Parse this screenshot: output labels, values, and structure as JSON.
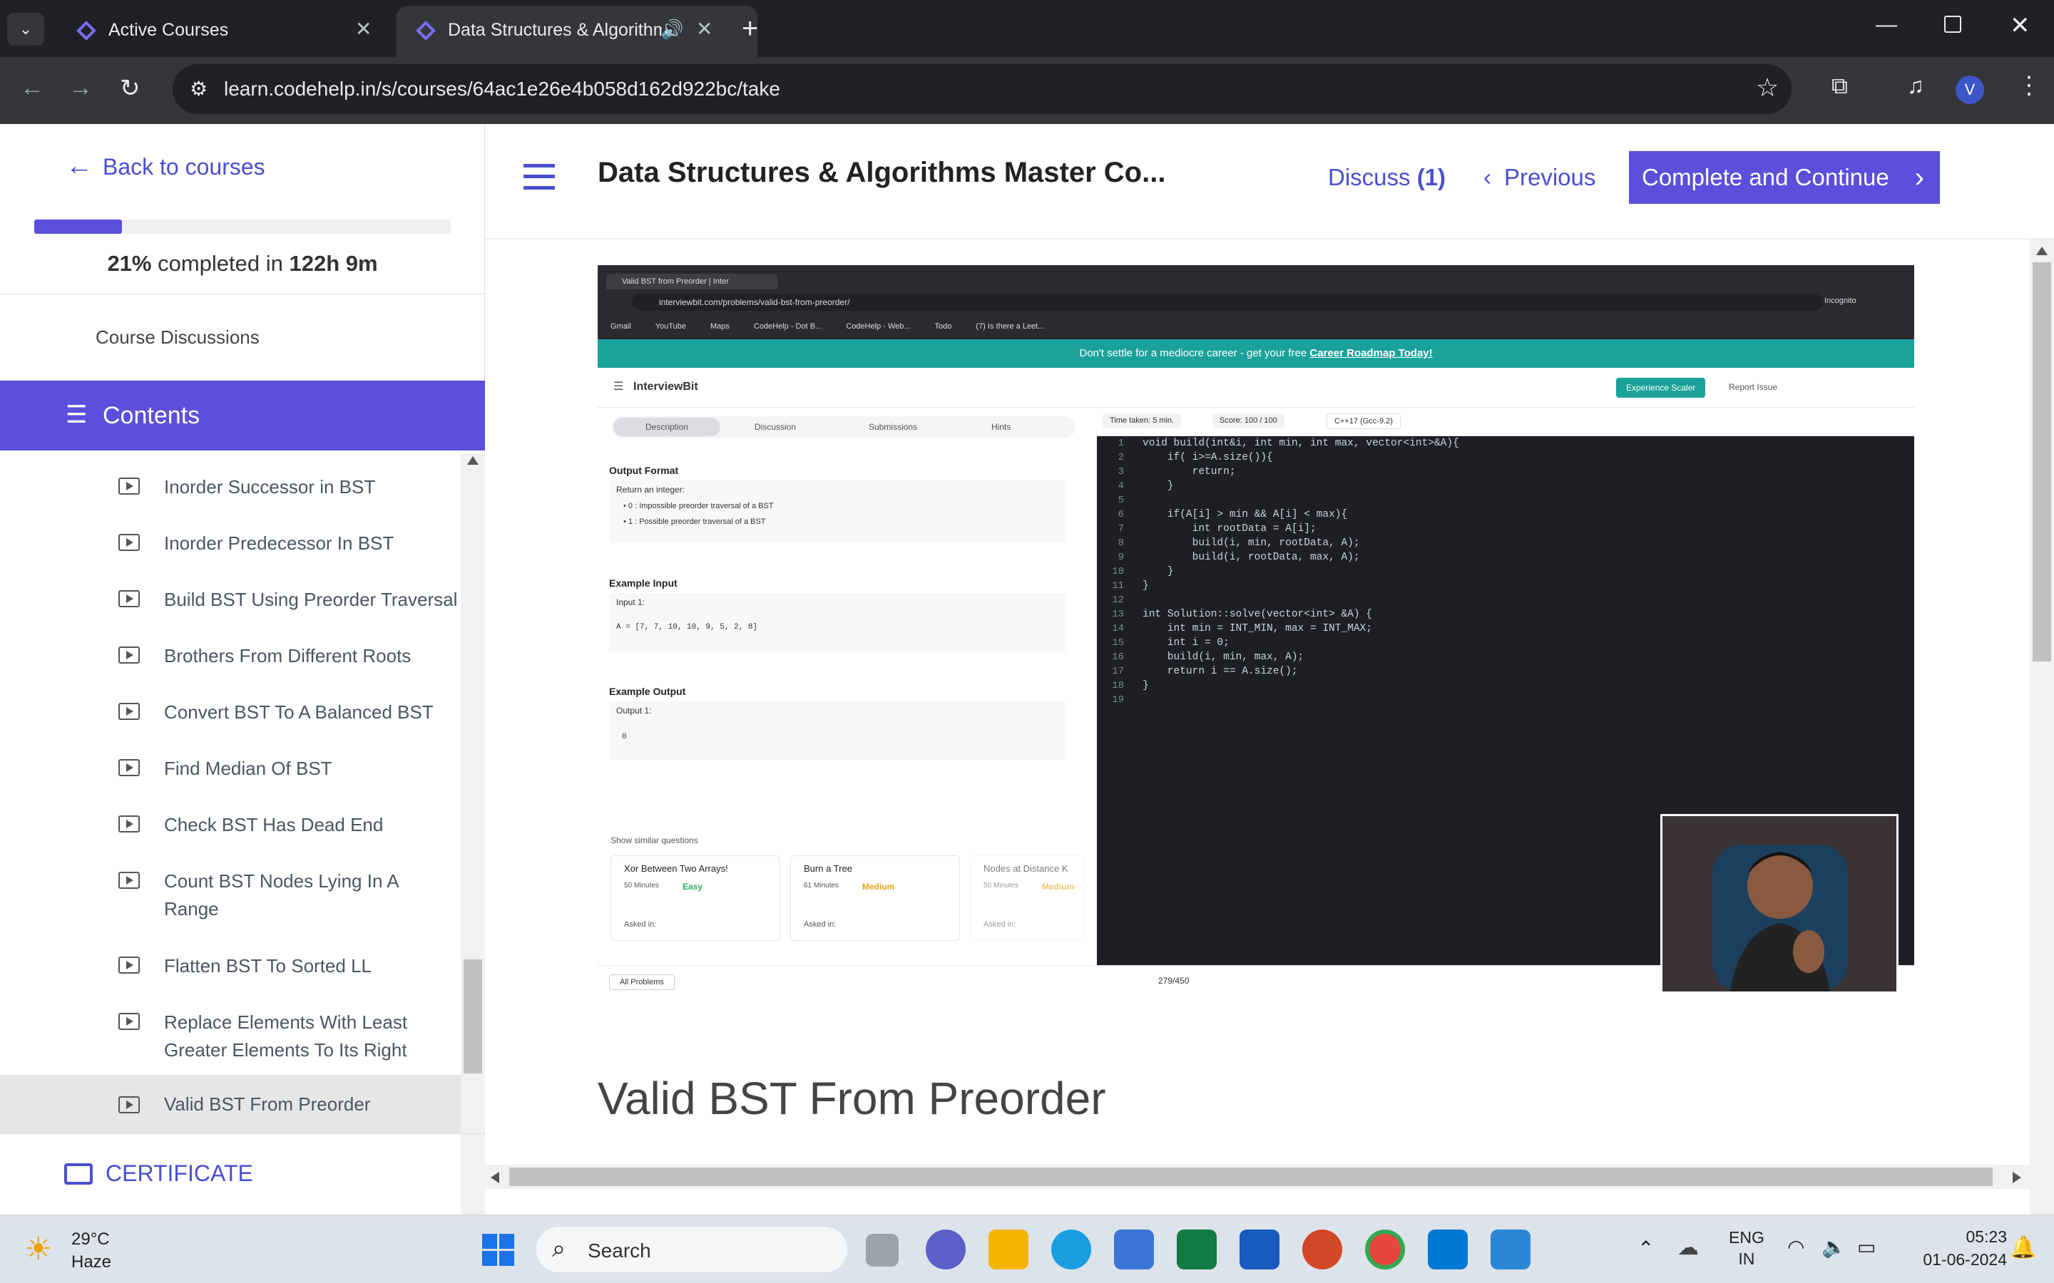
{
  "browser": {
    "tabs": [
      {
        "title": "Active Courses"
      },
      {
        "title": "Data Structures & Algorithm"
      }
    ],
    "url": "learn.codehelp.in/s/courses/64ac1e26e4b058d162d922bc/take",
    "profile_initial": "V"
  },
  "sidebar": {
    "back_label": "Back to courses",
    "progress_pct": "21%",
    "progress_fraction": 0.21,
    "completed_text": " completed in ",
    "time_spent": "122h 9m",
    "discussions_label": "Course Discussions",
    "contents_label": "Contents",
    "lessons": [
      "Inorder Successor in BST",
      "Inorder Predecessor In BST",
      "Build BST Using Preorder Traversal",
      "Brothers From Different Roots",
      "Convert BST To A Balanced BST",
      "Find Median Of BST",
      "Check BST Has Dead End",
      "Count BST Nodes Lying In A Range",
      "Flatten BST To Sorted LL",
      "Replace Elements With Least Greater Elements To Its Right",
      "Valid BST From Preorder"
    ],
    "certificate_label": "CERTIFICATE"
  },
  "header": {
    "course_title": "Data Structures & Algorithms Master Co...",
    "discuss_label": "Discuss",
    "discuss_count": "(1)",
    "previous_label": "Previous",
    "complete_label": "Complete and Continue"
  },
  "video": {
    "inner_tab": "Valid BST from Preorder | Inter",
    "inner_url": "interviewbit.com/problems/valid-bst-from-preorder/",
    "incognito": "Incognito",
    "bookmarks": [
      "Gmail",
      "YouTube",
      "Maps",
      "CodeHelp - Dot B...",
      "CodeHelp - Web...",
      "Todo",
      "(7) Is there a Leet..."
    ],
    "banner_text": "Don't settle for a mediocre career - get your free",
    "banner_link": "Career Roadmap Today!",
    "ib_logo": "InterviewBit",
    "experience_btn": "Experience Scaler",
    "report_issue": "Report Issue",
    "problem_tabs": [
      "Description",
      "Discussion",
      "Submissions",
      "Hints"
    ],
    "time_taken": "Time taken: 5 min.",
    "score": "Score: 100 / 100",
    "language": "C++17 (Gcc-9.2)",
    "output_format_title": "Output Format",
    "output_intro": "Return an integer:",
    "output_items": [
      "0 : Impossible preorder traversal of a BST",
      "1 : Possible preorder traversal of a BST"
    ],
    "example_input_title": "Example Input",
    "input_label": "Input 1:",
    "input_value": "A = [7, 7, 10, 10, 9, 5, 2, 8]",
    "example_output_title": "Example Output",
    "output_label": "Output 1:",
    "output_value": "0",
    "similar_title": "Show similar questions",
    "similar": [
      {
        "name": "Xor Between Two Arrays!",
        "time": "50 Minutes",
        "level": "Easy",
        "asked": "Asked in:"
      },
      {
        "name": "Burn a Tree",
        "time": "61 Minutes",
        "level": "Medium",
        "asked": "Asked in:"
      },
      {
        "name": "Nodes at Distance K",
        "time": "50 Minutes",
        "level": "Medium",
        "asked": "Asked in:"
      }
    ],
    "all_problems": "All Problems",
    "pager": "279/450",
    "code_lines": [
      "void build(int&i, int min, int max, vector<int>&A){",
      "    if( i>=A.size()){",
      "        return;",
      "    }",
      "",
      "    if(A[i] > min && A[i] < max){",
      "        int rootData = A[i];",
      "        build(i, min, rootData, A);",
      "        build(i, rootData, max, A);",
      "    }",
      "}",
      "",
      "int Solution::solve(vector<int> &A) {",
      "    int min = INT_MIN, max = INT_MAX;",
      "    int i = 0;",
      "    build(i, min, max, A);",
      "    return i == A.size();",
      "}",
      ""
    ]
  },
  "lesson_title": "Valid BST From Preorder",
  "taskbar": {
    "temperature": "29°C",
    "weather": "Haze",
    "search_label": "Search",
    "lang_top": "ENG",
    "lang_bottom": "IN",
    "time": "05:23",
    "date": "01-06-2024"
  },
  "colors": {
    "accent": "#5b4fdb",
    "progress": "#5b4fdb",
    "tab_bg": "#202124",
    "easy": "#2eab5c",
    "medium": "#e8a317",
    "banner": "#1aa29a"
  }
}
